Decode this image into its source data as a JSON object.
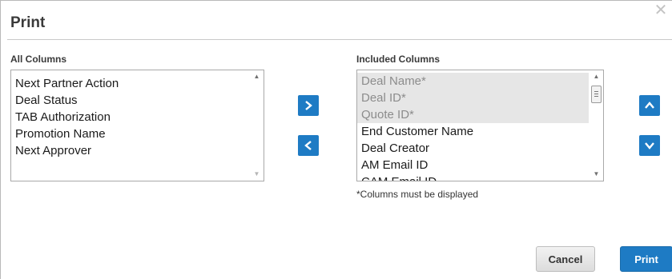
{
  "dialog": {
    "title": "Print",
    "close_icon": "close-icon"
  },
  "all_columns": {
    "label": "All Columns",
    "items": [
      "Next Partner Action",
      "Deal Status",
      "TAB Authorization",
      "Promotion Name",
      "Next Approver"
    ]
  },
  "included_columns": {
    "label": "Included Columns",
    "items": [
      {
        "label": "Deal Name*",
        "fixed": true
      },
      {
        "label": "Deal ID*",
        "fixed": true
      },
      {
        "label": "Quote ID*",
        "fixed": true
      },
      {
        "label": "End Customer Name",
        "fixed": false
      },
      {
        "label": "Deal Creator",
        "fixed": false
      },
      {
        "label": "AM Email ID",
        "fixed": false
      },
      {
        "label": "CAM Email ID",
        "fixed": false
      }
    ],
    "note": "*Columns must be displayed"
  },
  "controls": {
    "add_icon": "chevron-right-icon",
    "remove_icon": "chevron-left-icon",
    "move_up_icon": "chevron-up-icon",
    "move_down_icon": "chevron-down-icon"
  },
  "footer": {
    "cancel_label": "Cancel",
    "print_label": "Print"
  },
  "colors": {
    "accent": "#1e7bc4",
    "fixed_item_bg": "#e6e6e6",
    "fixed_item_text": "#8c8c8c"
  }
}
